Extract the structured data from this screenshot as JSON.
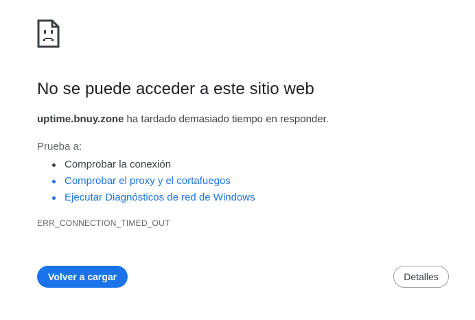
{
  "error_page": {
    "icon": "sad-page-icon",
    "title": "No se puede acceder a este sitio web",
    "summary": {
      "host": "uptime.bnuy.zone",
      "message": " ha tardado demasiado tiempo en responder."
    },
    "try_label": "Prueba a:",
    "suggestions": [
      {
        "text": "Comprobar la conexión",
        "is_link": false
      },
      {
        "text": "Comprobar el proxy y el cortafuegos",
        "is_link": true
      },
      {
        "text": "Ejecutar Diagnósticos de red de Windows",
        "is_link": true
      }
    ],
    "error_code": "ERR_CONNECTION_TIMED_OUT",
    "reload_label": "Volver a cargar",
    "details_label": "Detalles"
  },
  "colors": {
    "accent": "#1a73e8",
    "text": "#3c4043",
    "heading": "#202124",
    "muted": "#5f6368"
  }
}
